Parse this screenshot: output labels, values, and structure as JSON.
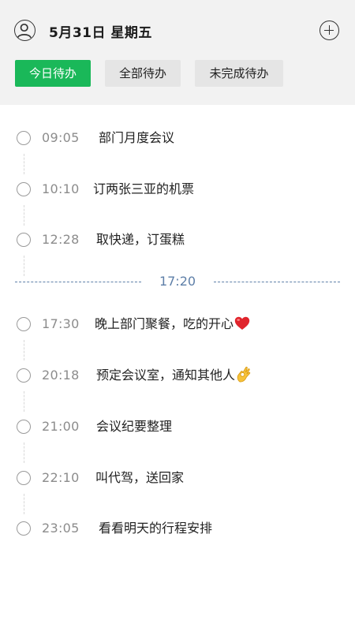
{
  "header": {
    "date_title": "5月31日  星期五",
    "avatar_icon": "user-outline-icon",
    "add_icon": "plus-circle-icon",
    "background": "#f2f2f2"
  },
  "tabs": [
    {
      "label": "今日待办",
      "active": true
    },
    {
      "label": "全部待办",
      "active": false
    },
    {
      "label": "未完成待办",
      "active": false
    }
  ],
  "accent_color": "#1ab859",
  "current_time_divider": "17:20",
  "todos_before": [
    {
      "time": "09:05",
      "text": "部门月度会议"
    },
    {
      "time": "10:10",
      "text": "订两张三亚的机票"
    },
    {
      "time": "12:28",
      "text": "取快递，订蛋糕"
    }
  ],
  "todos_after": [
    {
      "time": "17:30",
      "text": "晚上部门聚餐，吃的开心",
      "emoji": "red-heart-icon"
    },
    {
      "time": "20:18",
      "text": "预定会议室，通知其他人",
      "emoji": "ok-hand-icon"
    },
    {
      "time": "21:00",
      "text": "会议纪要整理"
    },
    {
      "time": "22:10",
      "text": "叫代驾，送回家"
    },
    {
      "time": "23:05",
      "text": "看看明天的行程安排"
    }
  ]
}
